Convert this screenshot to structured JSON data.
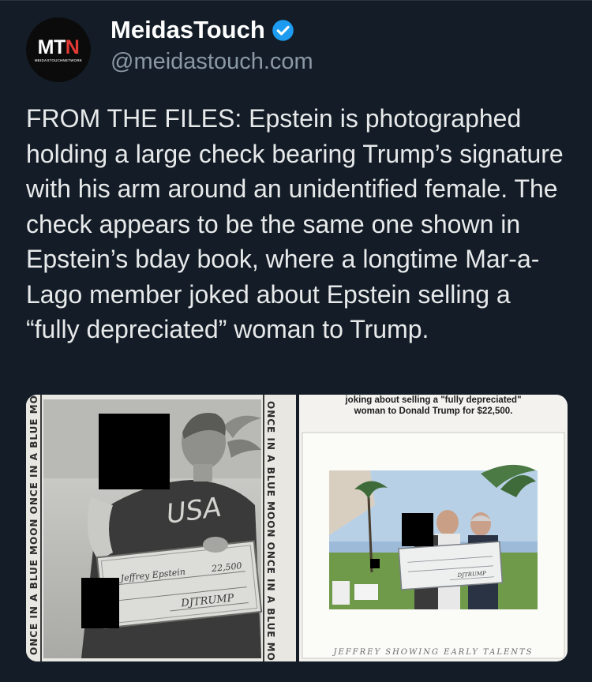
{
  "author": {
    "avatar_text_main": "MT",
    "avatar_text_accent": "N",
    "avatar_subtext": "MEIDASTOUCHNETWORK",
    "display_name": "MeidasTouch",
    "handle": "@meidastouch.com",
    "verified": true
  },
  "post": {
    "text": "FROM THE FILES: Epstein is photographed holding a large check bearing Trump’s signature with his arm around an unidentified female. The check appears to be the same one shown in Epstein’s bday book, where a longtime Mar-a-Lago member joked about Epstein selling a “fully depreciated” woman to Trump."
  },
  "media": {
    "right_caption_line1": "joking about selling a \"fully depreciated\"",
    "right_caption_line2": "woman to Donald Trump for $22,500.",
    "right_handwritten": "JEFFREY SHOWING EARLY TALENTS",
    "left_border_text": "ONCE IN A BLUE MOON ONCE IN A BLUE MOON",
    "shirt_text": "USA",
    "check_payee": "Jeffrey Epstein",
    "check_amount": "22,500",
    "check_signature": "DJTRUMP"
  },
  "colors": {
    "background": "#141d27",
    "text": "#e7e9ea",
    "secondary": "#8b98a5",
    "verified": "#1d9bf0",
    "accent_red": "#e53935"
  }
}
